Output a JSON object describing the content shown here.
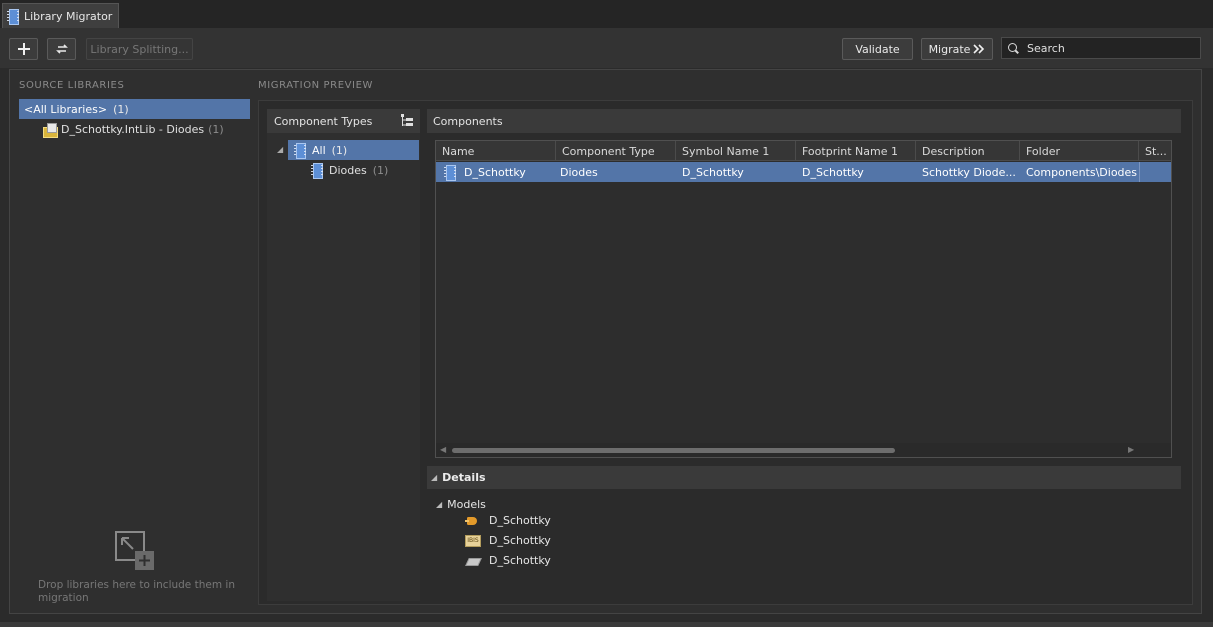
{
  "tab": {
    "title": "Library Migrator"
  },
  "toolbar": {
    "add_icon": "plus-icon",
    "swap_icon": "swap-icon",
    "library_splitting_label": "Library Splitting...",
    "validate_label": "Validate",
    "migrate_label": "Migrate",
    "search_placeholder": "Search"
  },
  "source": {
    "title": "SOURCE LIBRARIES",
    "items": [
      {
        "label": "<All Libraries>",
        "count": "(1)"
      },
      {
        "label": "D_Schottky.IntLib - Diodes",
        "count": "(1)"
      }
    ],
    "drop_text": "Drop libraries here to include them in migration"
  },
  "preview": {
    "title": "MIGRATION PREVIEW",
    "component_types": {
      "header": "Component Types",
      "items": [
        {
          "label": "All",
          "count": "(1)"
        },
        {
          "label": "Diodes",
          "count": "(1)"
        }
      ]
    },
    "components": {
      "header": "Components",
      "columns": [
        "Name",
        "Component Type",
        "Symbol Name 1",
        "Footprint Name 1",
        "Description",
        "Folder",
        "St..."
      ],
      "rows": [
        [
          "D_Schottky",
          "Diodes",
          "D_Schottky",
          "D_Schottky",
          "Schottky Diode...",
          "Components\\Diodes",
          ""
        ]
      ]
    },
    "details": {
      "header": "Details",
      "models_label": "Models",
      "models": [
        {
          "name": "D_Schottky",
          "icon": "symbol-model-icon"
        },
        {
          "name": "D_Schottky",
          "icon": "ibis-model-icon"
        },
        {
          "name": "D_Schottky",
          "icon": "footprint-model-icon"
        }
      ]
    }
  },
  "colors": {
    "selection": "#5375a8",
    "background": "#2b2b2b",
    "panel_header": "#3a3a3a"
  }
}
